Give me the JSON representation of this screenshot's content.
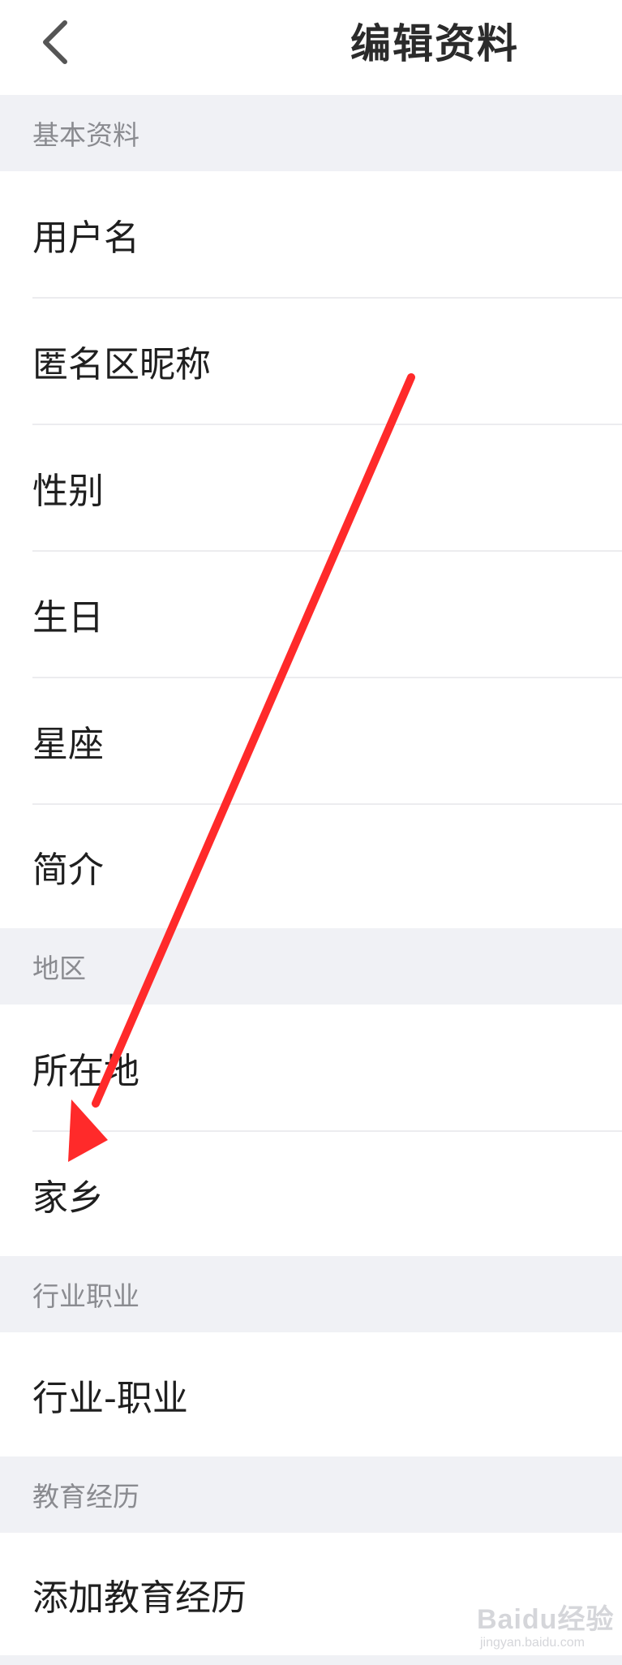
{
  "header": {
    "back_icon": "chevron-left-icon",
    "title": "编辑资料"
  },
  "sections": {
    "basic": {
      "title": "基本资料",
      "items": [
        "用户名",
        "匿名区昵称",
        "性别",
        "生日",
        "星座",
        "简介"
      ]
    },
    "region": {
      "title": "地区",
      "items": [
        "所在地",
        "家乡"
      ]
    },
    "career": {
      "title": "行业职业",
      "items": [
        "行业-职业"
      ]
    },
    "education": {
      "title": "教育经历",
      "items": [
        "添加教育经历"
      ]
    }
  },
  "annotation": {
    "arrow_color": "#ff2a2a"
  },
  "watermark": {
    "text": "Baidu经验",
    "sub": "jingyan.baidu.com"
  }
}
